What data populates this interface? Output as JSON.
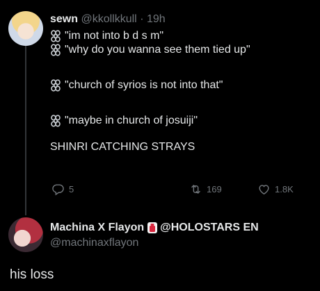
{
  "tweet": {
    "display_name": "sewn",
    "handle": "@kkollkkull",
    "separator": "·",
    "timestamp": "19h",
    "lines": [
      "\"im not into b d s m\"",
      "\"why do you wanna see them tied up\"",
      "\"church of syrios is not into that\"",
      "\"maybe in church of josuiji\""
    ],
    "closing": "SHINRI CATCHING STRAYS",
    "reply_count": "5",
    "retweet_count": "169",
    "like_count": "1.8K"
  },
  "reply": {
    "display_name": "Machina X Flayon",
    "affiliation": "@HOLOSTARS EN",
    "handle": "@machinaxflayon",
    "text": "his loss"
  },
  "colors": {
    "background": "#000000",
    "text": "#e7e9ea",
    "muted": "#71767b",
    "thread_line": "#333639"
  },
  "icons": [
    "chain-icon",
    "reply-icon",
    "retweet-icon",
    "like-icon",
    "affiliate-badge-icon"
  ]
}
